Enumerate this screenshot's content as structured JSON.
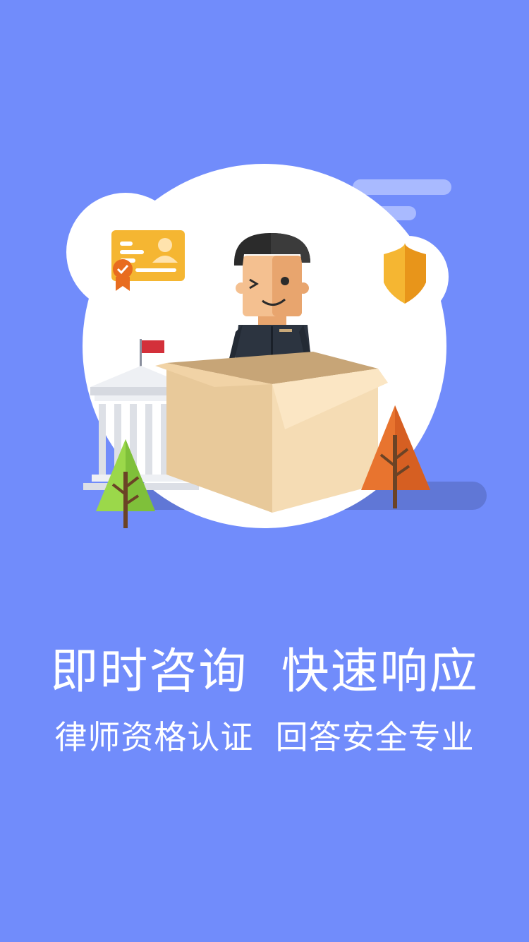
{
  "onboarding": {
    "title": "即时咨询  快速响应",
    "subtitle": "律师资格认证  回答安全专业"
  },
  "colors": {
    "background": "#718cfb",
    "bubble": "#ffffff",
    "box": "#f2d5a8",
    "shield": "#f5b632",
    "card": "#f5b632",
    "tree_green": "#8dce3e",
    "tree_orange": "#e0692d",
    "flag": "#d3303a"
  },
  "icons": [
    "lawyer-character",
    "cardboard-box",
    "license-card-icon",
    "shield-icon",
    "courthouse-icon",
    "green-tree-icon",
    "orange-tree-icon",
    "cloud-streak"
  ]
}
